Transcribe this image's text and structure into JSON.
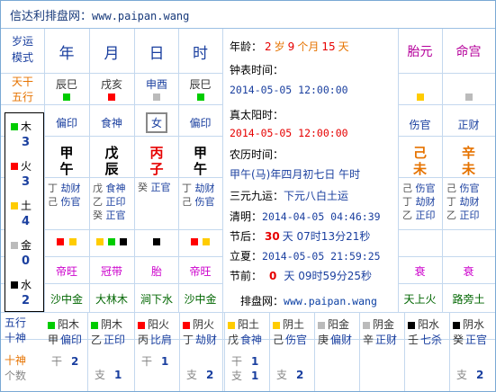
{
  "header": {
    "title": "信达利排盘网：",
    "url": "www.paipan.wang"
  },
  "left_col": {
    "suiyun": [
      "岁运",
      "模式"
    ],
    "tiangan_wuxing": [
      "天干",
      "五行"
    ],
    "elements": [
      {
        "name": "木",
        "count": "3",
        "color": "green"
      },
      {
        "name": "火",
        "count": "3",
        "color": "red"
      },
      {
        "name": "土",
        "count": "4",
        "color": "yellow"
      },
      {
        "name": "金",
        "count": "0",
        "color": "gray"
      },
      {
        "name": "水",
        "count": "2",
        "color": "black"
      }
    ]
  },
  "pillars": [
    {
      "header": "年",
      "kong": "辰巳",
      "kong_color": "green",
      "shishen": "偏印",
      "gan": "甲",
      "zhi": "午",
      "gan_color": "dk",
      "zhi_color": "dk",
      "canggan": [
        {
          "g": "丁",
          "s": "劫财"
        },
        {
          "g": "己",
          "s": "伤官"
        }
      ],
      "colors": [
        "red",
        "yellow"
      ],
      "state": "帝旺",
      "nayin": "沙中金"
    },
    {
      "header": "月",
      "kong": "戌亥",
      "kong_color": "red",
      "shishen": "食神",
      "gan": "戊",
      "zhi": "辰",
      "gan_color": "dk",
      "zhi_color": "dk",
      "canggan": [
        {
          "g": "戊",
          "s": "食神"
        },
        {
          "g": "乙",
          "s": "正印"
        },
        {
          "g": "癸",
          "s": "正官"
        }
      ],
      "colors": [
        "yellow",
        "green",
        "black"
      ],
      "state": "冠带",
      "nayin": "大林木"
    },
    {
      "header": "日",
      "kong": "申酉",
      "kong_color": "gray",
      "shishen": "女",
      "gan": "丙",
      "zhi": "子",
      "gan_color": "red",
      "zhi_color": "red",
      "canggan": [
        {
          "g": "癸",
          "s": "正官"
        }
      ],
      "colors": [
        "black"
      ],
      "state": "胎",
      "nayin": "涧下水"
    },
    {
      "header": "时",
      "kong": "辰巳",
      "kong_color": "green",
      "shishen": "偏印",
      "gan": "甲",
      "zhi": "午",
      "gan_color": "dk",
      "zhi_color": "dk",
      "canggan": [
        {
          "g": "丁",
          "s": "劫财"
        },
        {
          "g": "己",
          "s": "伤官"
        }
      ],
      "colors": [
        "red",
        "yellow"
      ],
      "state": "帝旺",
      "nayin": "沙中金"
    }
  ],
  "middle": {
    "age_label": "年龄：",
    "age": "2",
    "age_unit1": "岁",
    "age_m": "9",
    "age_unit2": "个月",
    "age_d": "15",
    "age_unit3": "天",
    "clock_label": "钟表时间：",
    "clock": "2014-05-05 12:00:00",
    "solar_label": "真太阳时：",
    "solar": "2014-05-05 12:00:00",
    "lunar_label": "农历时间：",
    "lunar": "甲午(马)年四月初七日 午时",
    "sanyuan_label": "三元九运：",
    "sanyuan": "下元八白土运",
    "qingming_label": "清明：",
    "qingming": "2014-04-05 04:46:39",
    "after_label": "节后：",
    "after_d": "30",
    "after_rest": "天 07时13分21秒",
    "lixia_label": "立夏：",
    "lixia": "2014-05-05 21:59:25",
    "before_label": "节前：",
    "before_d": "0",
    "before_rest": "天 09时59分25秒",
    "site_label": "排盘网：",
    "site": "www.paipan.wang"
  },
  "right": {
    "taiyuan": {
      "header": "胎元",
      "color": "yellow",
      "shishen": "伤官",
      "gan": "己",
      "zhi": "未",
      "canggan": [
        {
          "g": "己",
          "s": "伤官"
        },
        {
          "g": "丁",
          "s": "劫财"
        },
        {
          "g": "乙",
          "s": "正印"
        }
      ],
      "state": "衰",
      "nayin": "天上火"
    },
    "minggong": {
      "header": "命宫",
      "color": "gray",
      "shishen": "正财",
      "gan": "辛",
      "zhi": "未",
      "canggan": [
        {
          "g": "己",
          "s": "伤官"
        },
        {
          "g": "丁",
          "s": "劫财"
        },
        {
          "g": "乙",
          "s": "正印"
        }
      ],
      "state": "衰",
      "nayin": "路旁土"
    }
  },
  "bottom": {
    "row_labels": [
      [
        "五行",
        "十神"
      ],
      [
        "十神",
        "个数"
      ]
    ],
    "cells": [
      {
        "c": "green",
        "a": "阳木",
        "g": "甲",
        "s": "偏印"
      },
      {
        "c": "green",
        "a": "阴木",
        "g": "乙",
        "s": "正印"
      },
      {
        "c": "red",
        "a": "阳火",
        "g": "丙",
        "s": "比肩"
      },
      {
        "c": "red",
        "a": "阴火",
        "g": "丁",
        "s": "劫财"
      },
      {
        "c": "yellow",
        "a": "阳土",
        "g": "戊",
        "s": "食神"
      },
      {
        "c": "yellow",
        "a": "阴土",
        "g": "己",
        "s": "伤官"
      },
      {
        "c": "gray",
        "a": "阳金",
        "g": "庚",
        "s": "偏财"
      },
      {
        "c": "gray",
        "a": "阴金",
        "g": "辛",
        "s": "正财"
      },
      {
        "c": "black",
        "a": "阳水",
        "g": "壬",
        "s": "七杀"
      },
      {
        "c": "black",
        "a": "阴水",
        "g": "癸",
        "s": "正官"
      }
    ],
    "counts": [
      {
        "k": "干",
        "v": "2"
      },
      {
        "k": "支",
        "v": "1"
      },
      {
        "k": "干",
        "v": "1"
      },
      {
        "k": "支",
        "v": "2"
      },
      {
        "k": "干",
        "v": "1",
        "k2": "支",
        "v2": "1"
      },
      {
        "k": "支",
        "v": "2"
      },
      {
        "k": "",
        "v": ""
      },
      {
        "k": "",
        "v": ""
      },
      {
        "k": "",
        "v": ""
      },
      {
        "k": "支",
        "v": "2"
      }
    ]
  }
}
